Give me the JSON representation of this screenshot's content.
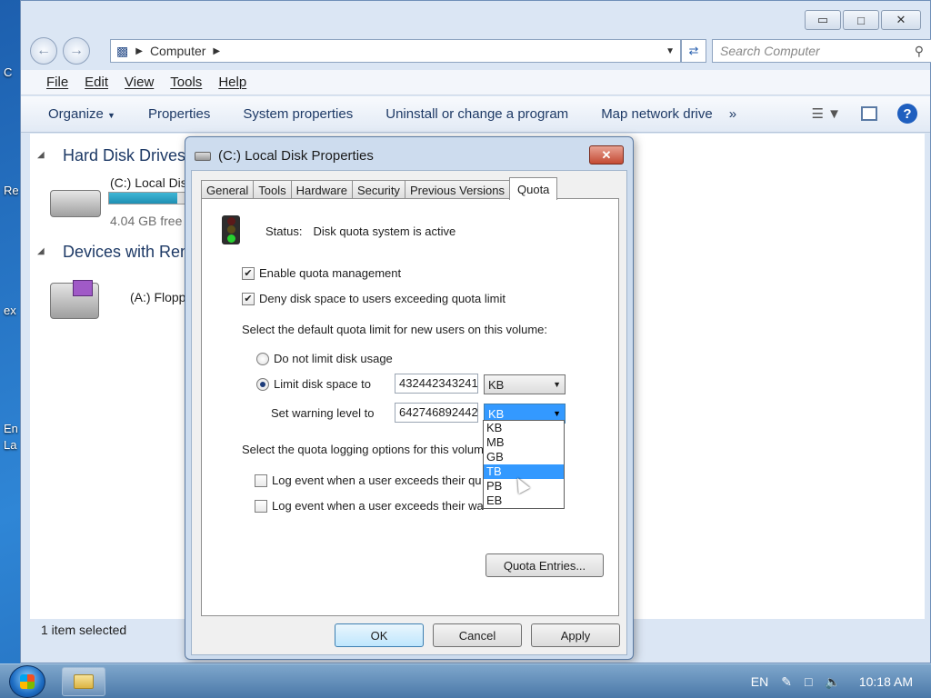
{
  "desktop": {
    "icons": [
      "C",
      "Re",
      "ex",
      "En",
      "La"
    ]
  },
  "explorer": {
    "window_controls": {
      "minimize": "▭",
      "maximize": "□",
      "close": "✕"
    },
    "address": {
      "location": "Computer"
    },
    "search": {
      "placeholder": "Search Computer"
    },
    "menu": [
      "File",
      "Edit",
      "View",
      "Tools",
      "Help"
    ],
    "commands": [
      "Organize",
      "Properties",
      "System properties",
      "Uninstall or change a program",
      "Map network drive",
      "»"
    ],
    "groups": {
      "hard_disk": "Hard Disk Drives (",
      "devices": "Devices with Remo"
    },
    "drives": {
      "c_label": "(C:) Local Dis",
      "c_free": "4.04 GB free",
      "c_used_fraction": 0.85,
      "a_label": "(A:) Floppy D"
    },
    "status": "1 item selected"
  },
  "dialog": {
    "title": "(C:) Local Disk Properties",
    "tabs": [
      "General",
      "Tools",
      "Hardware",
      "Security",
      "Previous Versions",
      "Quota"
    ],
    "status_label": "Status:",
    "status_value": "Disk quota system is active",
    "enable_quota": "Enable quota management",
    "deny_space": "Deny disk space to users exceeding quota limit",
    "default_limit_heading": "Select the default quota limit for new users on this volume:",
    "no_limit": "Do not limit disk usage",
    "limit_to": "Limit disk space to",
    "limit_value": "432442343241",
    "limit_unit": "KB",
    "warning_label": "Set warning level to",
    "warning_value": "642746892442",
    "warning_unit": "KB",
    "unit_options": [
      "KB",
      "MB",
      "GB",
      "TB",
      "PB",
      "EB"
    ],
    "highlighted_option": "TB",
    "logging_heading": "Select the quota logging options for this volum",
    "log_quota": "Log event when a user exceeds their qu",
    "log_warning": "Log event when a user exceeds their wa",
    "quota_entries": "Quota Entries...",
    "ok": "OK",
    "cancel": "Cancel",
    "apply": "Apply"
  },
  "taskbar": {
    "language": "EN",
    "time": "10:18 AM"
  }
}
